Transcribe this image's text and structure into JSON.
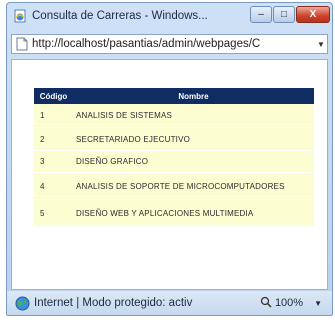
{
  "window": {
    "title": "Consulta de Carreras - Windows...",
    "minimize_label": "–",
    "maximize_label": "□",
    "close_label": "X"
  },
  "address": {
    "url": "http://localhost/pasantias/admin/webpages/C",
    "dropdown": "▼"
  },
  "table": {
    "headers": {
      "code": "Código",
      "name": "Nombre"
    },
    "rows": [
      {
        "code": "1",
        "name": "ANALISIS DE SISTEMAS"
      },
      {
        "code": "2",
        "name": "SECRETARIADO EJECUTIVO"
      },
      {
        "code": "3",
        "name": "DISEÑO GRAFICO"
      },
      {
        "code": "4",
        "name": "ANALISIS DE SOPORTE DE MICROCOMPUTADORES"
      },
      {
        "code": "5",
        "name": "DISEÑO WEB Y APLICACIONES MULTIMEDIA"
      }
    ]
  },
  "status": {
    "text": "Internet | Modo protegido: activ",
    "zoom": "100%",
    "zoom_dropdown": "▼"
  },
  "icons": {
    "app": "ie-page-icon",
    "page": "page-icon",
    "globe": "globe-icon",
    "zoom": "magnifier-icon"
  },
  "colors": {
    "header_bg": "#0f2d63",
    "row_bg": "#fdfdd2",
    "close_button": "#c9422b"
  }
}
